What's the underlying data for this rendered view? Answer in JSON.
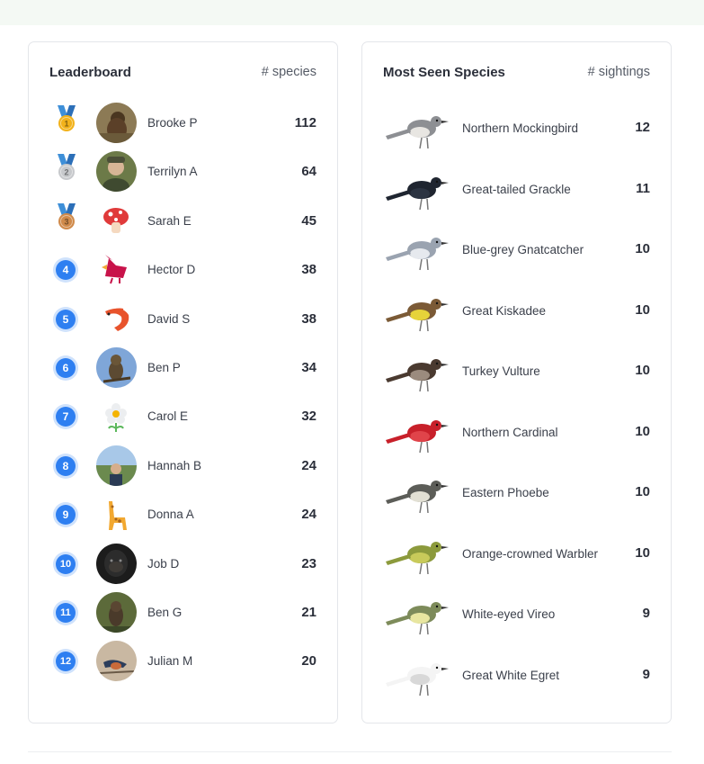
{
  "leaderboard": {
    "title": "Leaderboard",
    "subtitle": "# species",
    "rows": [
      {
        "rank": "1",
        "medal": "gold",
        "avatar": "hawk-photo",
        "name": "Brooke P",
        "count": "112"
      },
      {
        "rank": "2",
        "medal": "silver",
        "avatar": "person-photo",
        "name": "Terrilyn A",
        "count": "64"
      },
      {
        "rank": "3",
        "medal": "bronze",
        "avatar": "mushroom-emoji",
        "name": "Sarah E",
        "count": "45"
      },
      {
        "rank": "4",
        "avatar": "cardinal-emoji",
        "name": "Hector D",
        "count": "38"
      },
      {
        "rank": "5",
        "avatar": "shrimp-emoji",
        "name": "David S",
        "count": "38"
      },
      {
        "rank": "6",
        "avatar": "bird-photo-sky",
        "name": "Ben P",
        "count": "34"
      },
      {
        "rank": "7",
        "avatar": "flower-emoji",
        "name": "Carol E",
        "count": "32"
      },
      {
        "rank": "8",
        "avatar": "landscape-person-photo",
        "name": "Hannah B",
        "count": "24"
      },
      {
        "rank": "9",
        "avatar": "giraffe-emoji",
        "name": "Donna A",
        "count": "24"
      },
      {
        "rank": "10",
        "avatar": "gorilla-photo",
        "name": "Job D",
        "count": "23"
      },
      {
        "rank": "11",
        "avatar": "owl-photo",
        "name": "Ben G",
        "count": "21"
      },
      {
        "rank": "12",
        "avatar": "swallow-photo",
        "name": "Julian M",
        "count": "20"
      }
    ]
  },
  "species": {
    "title": "Most Seen Species",
    "subtitle": "# sightings",
    "rows": [
      {
        "name": "Northern Mockingbird",
        "count": "12",
        "colors": [
          "#8d8f93",
          "#e8e6e2"
        ]
      },
      {
        "name": "Great-tailed Grackle",
        "count": "11",
        "colors": [
          "#1f2530",
          "#2c3442"
        ]
      },
      {
        "name": "Blue-grey Gnatcatcher",
        "count": "10",
        "colors": [
          "#9aa3b0",
          "#e6e9ee"
        ]
      },
      {
        "name": "Great Kiskadee",
        "count": "10",
        "colors": [
          "#7b5a36",
          "#e6d33a"
        ]
      },
      {
        "name": "Turkey Vulture",
        "count": "10",
        "colors": [
          "#4a3a30",
          "#9b8b7e"
        ]
      },
      {
        "name": "Northern Cardinal",
        "count": "10",
        "colors": [
          "#c8202a",
          "#e0444a"
        ]
      },
      {
        "name": "Eastern Phoebe",
        "count": "10",
        "colors": [
          "#5c5d58",
          "#e2e0d4"
        ]
      },
      {
        "name": "Orange-crowned Warbler",
        "count": "10",
        "colors": [
          "#8c9a3c",
          "#c8ca5a"
        ]
      },
      {
        "name": "White-eyed Vireo",
        "count": "9",
        "colors": [
          "#7d8b5a",
          "#e8e6a0"
        ]
      },
      {
        "name": "Great White Egret",
        "count": "9",
        "colors": [
          "#f4f4f4",
          "#d8d8d8"
        ]
      }
    ]
  },
  "colors": {
    "rank_blue": "#2e7ff1",
    "gold": "#f2b21b",
    "silver": "#c7c9cc",
    "bronze": "#d08a4a",
    "ribbon": "#3e8fd8"
  }
}
